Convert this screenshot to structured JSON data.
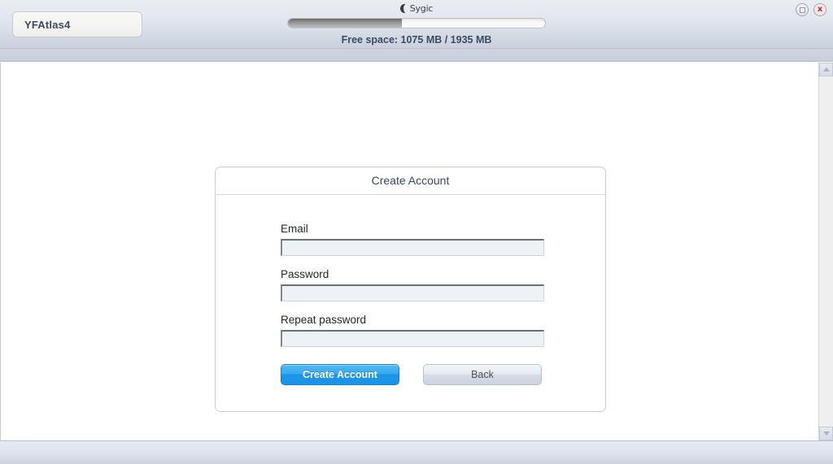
{
  "window": {
    "brand": "Sygic",
    "brand_icon": "crescent-moon-icon",
    "controls": [
      {
        "name": "restore-button",
        "icon": "square-icon",
        "label": ""
      },
      {
        "name": "close-button",
        "icon": "close-x-icon",
        "label": "x"
      }
    ]
  },
  "header": {
    "device_tab_label": "YFAtlas4",
    "free_space_text": "Free space: 1075 MB / 1935 MB",
    "storage": {
      "free_mb": 1075,
      "total_mb": 1935,
      "used_mb": 860,
      "used_percent": 44.4
    }
  },
  "dialog": {
    "title": "Create Account",
    "fields": [
      {
        "label": "Email",
        "value": "",
        "placeholder": "",
        "name": "email-field"
      },
      {
        "label": "Password",
        "value": "",
        "placeholder": "",
        "name": "password-field"
      },
      {
        "label": "Repeat password",
        "value": "",
        "placeholder": "",
        "name": "repeat-password-field"
      }
    ],
    "buttons": {
      "primary_label": "Create Account",
      "secondary_label": "Back"
    }
  },
  "colors": {
    "primary_button": "#1c95e8",
    "header_gradient_top": "#e9edf2",
    "header_gradient_bottom": "#cad1dd",
    "text_dark": "#3d4a63",
    "close_x": "#d61d1d"
  },
  "scrollbar": {
    "up_arrow": "chevron-up-icon",
    "down_arrow": "chevron-down-icon"
  }
}
